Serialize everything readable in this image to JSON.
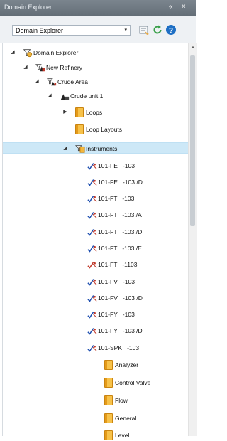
{
  "window": {
    "title": "Domain Explorer",
    "pin_glyph": "«",
    "close_glyph": "×"
  },
  "toolbar": {
    "dropdown_value": "Domain Explorer",
    "dropdown_arrow": "▾",
    "icons": [
      "filter-icon",
      "refresh-icon",
      "help-icon"
    ],
    "colors": {
      "refresh": "#3aa04a",
      "help": "#1e6fc4"
    }
  },
  "tree": {
    "nodes": [
      {
        "label": "Domain Explorer",
        "expander": "◢",
        "icon": "domain-icon"
      },
      {
        "label": "New Refinery",
        "expander": "◢",
        "icon": "plant-icon"
      },
      {
        "label": "Crude Area",
        "expander": "◢",
        "icon": "area-icon"
      },
      {
        "label": "Crude unit 1",
        "expander": "◢",
        "icon": "unit-icon"
      },
      {
        "label": "Loops",
        "expander": "▶",
        "icon": "folder-icon"
      },
      {
        "label": "Loop Layouts",
        "expander": "",
        "icon": "folder-icon"
      },
      {
        "label": "Instruments",
        "expander": "◢",
        "icon": "instruments-icon",
        "selected": true
      },
      {
        "label": "101-FE   -103",
        "icon": "instrument-ok-icon"
      },
      {
        "label": "101-FE   -103 /D",
        "icon": "instrument-ok-icon"
      },
      {
        "label": "101-FT   -103",
        "icon": "instrument-ok-icon"
      },
      {
        "label": "101-FT   -103 /A",
        "icon": "instrument-ok-icon"
      },
      {
        "label": "101-FT   -103 /D",
        "icon": "instrument-ok-icon"
      },
      {
        "label": "101-FT   -103 /E",
        "icon": "instrument-ok-icon"
      },
      {
        "label": "101-FT   -1103",
        "icon": "instrument-warn-icon"
      },
      {
        "label": "101-FV   -103",
        "icon": "instrument-ok-icon"
      },
      {
        "label": "101-FV   -103 /D",
        "icon": "instrument-ok-icon"
      },
      {
        "label": "101-FY   -103",
        "icon": "instrument-ok-icon"
      },
      {
        "label": "101-FY   -103 /D",
        "icon": "instrument-ok-icon"
      },
      {
        "label": "101-SPK   -103",
        "icon": "instrument-ok-icon"
      },
      {
        "label": "Analyzer",
        "icon": "folder-icon"
      },
      {
        "label": "Control Valve",
        "icon": "folder-icon"
      },
      {
        "label": "Flow",
        "icon": "folder-icon"
      },
      {
        "label": "General",
        "icon": "folder-icon"
      },
      {
        "label": "Level",
        "icon": "folder-icon"
      }
    ]
  }
}
